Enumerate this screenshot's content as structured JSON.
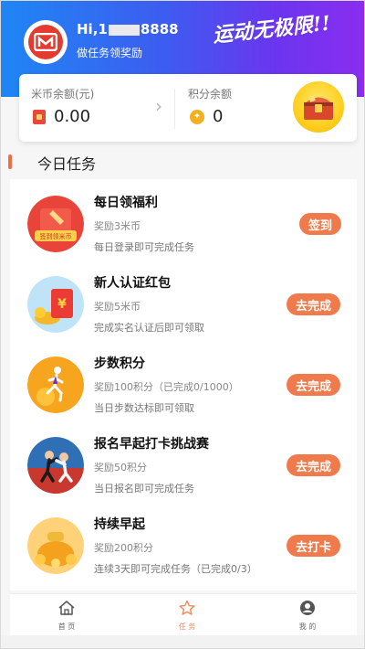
{
  "header": {
    "greeting_prefix": "Hi,1",
    "greeting_suffix": "8888",
    "subtitle": "做任务领奖励",
    "slogan": "运动无极限!!",
    "colors": {
      "gradient_start": "#1f86f4",
      "gradient_end": "#8a2df0"
    }
  },
  "balance": {
    "coin_label": "米币余额(元)",
    "coin_value": "0.00",
    "points_label": "积分余额",
    "points_value": "0"
  },
  "section_title": "今日任务",
  "tasks": [
    {
      "title": "每日领福利",
      "reward": "奖励3米币",
      "desc": "每日登录即可完成任务",
      "button": "签到",
      "icon": "red-envelope-checkin-icon",
      "icon_text": "签到领米币"
    },
    {
      "title": "新人认证红包",
      "reward": "奖励5米币",
      "desc": "完成实名认证后即可领取",
      "button": "去完成",
      "icon": "yen-red-envelope-icon"
    },
    {
      "title": "步数积分",
      "reward": "奖励100积分（已完成0/1000）",
      "desc": "当日步数达标即可领取",
      "button": "去完成",
      "icon": "running-person-icon"
    },
    {
      "title": "报名早起打卡挑战赛",
      "reward": "奖励50积分",
      "desc": "当日报名即可完成任务",
      "button": "去完成",
      "icon": "challenge-runners-icon"
    },
    {
      "title": "持续早起",
      "reward": "奖励200积分",
      "desc": "连续3天即可完成任务（已完成0/3）",
      "button": "去打卡",
      "icon": "gold-coins-bag-icon"
    }
  ],
  "nav": [
    {
      "label": "首 页",
      "icon": "home-icon"
    },
    {
      "label": "任 务",
      "icon": "star-icon",
      "active": true
    },
    {
      "label": "我 的",
      "icon": "user-icon"
    }
  ],
  "accent_color": "#ef7b4d"
}
